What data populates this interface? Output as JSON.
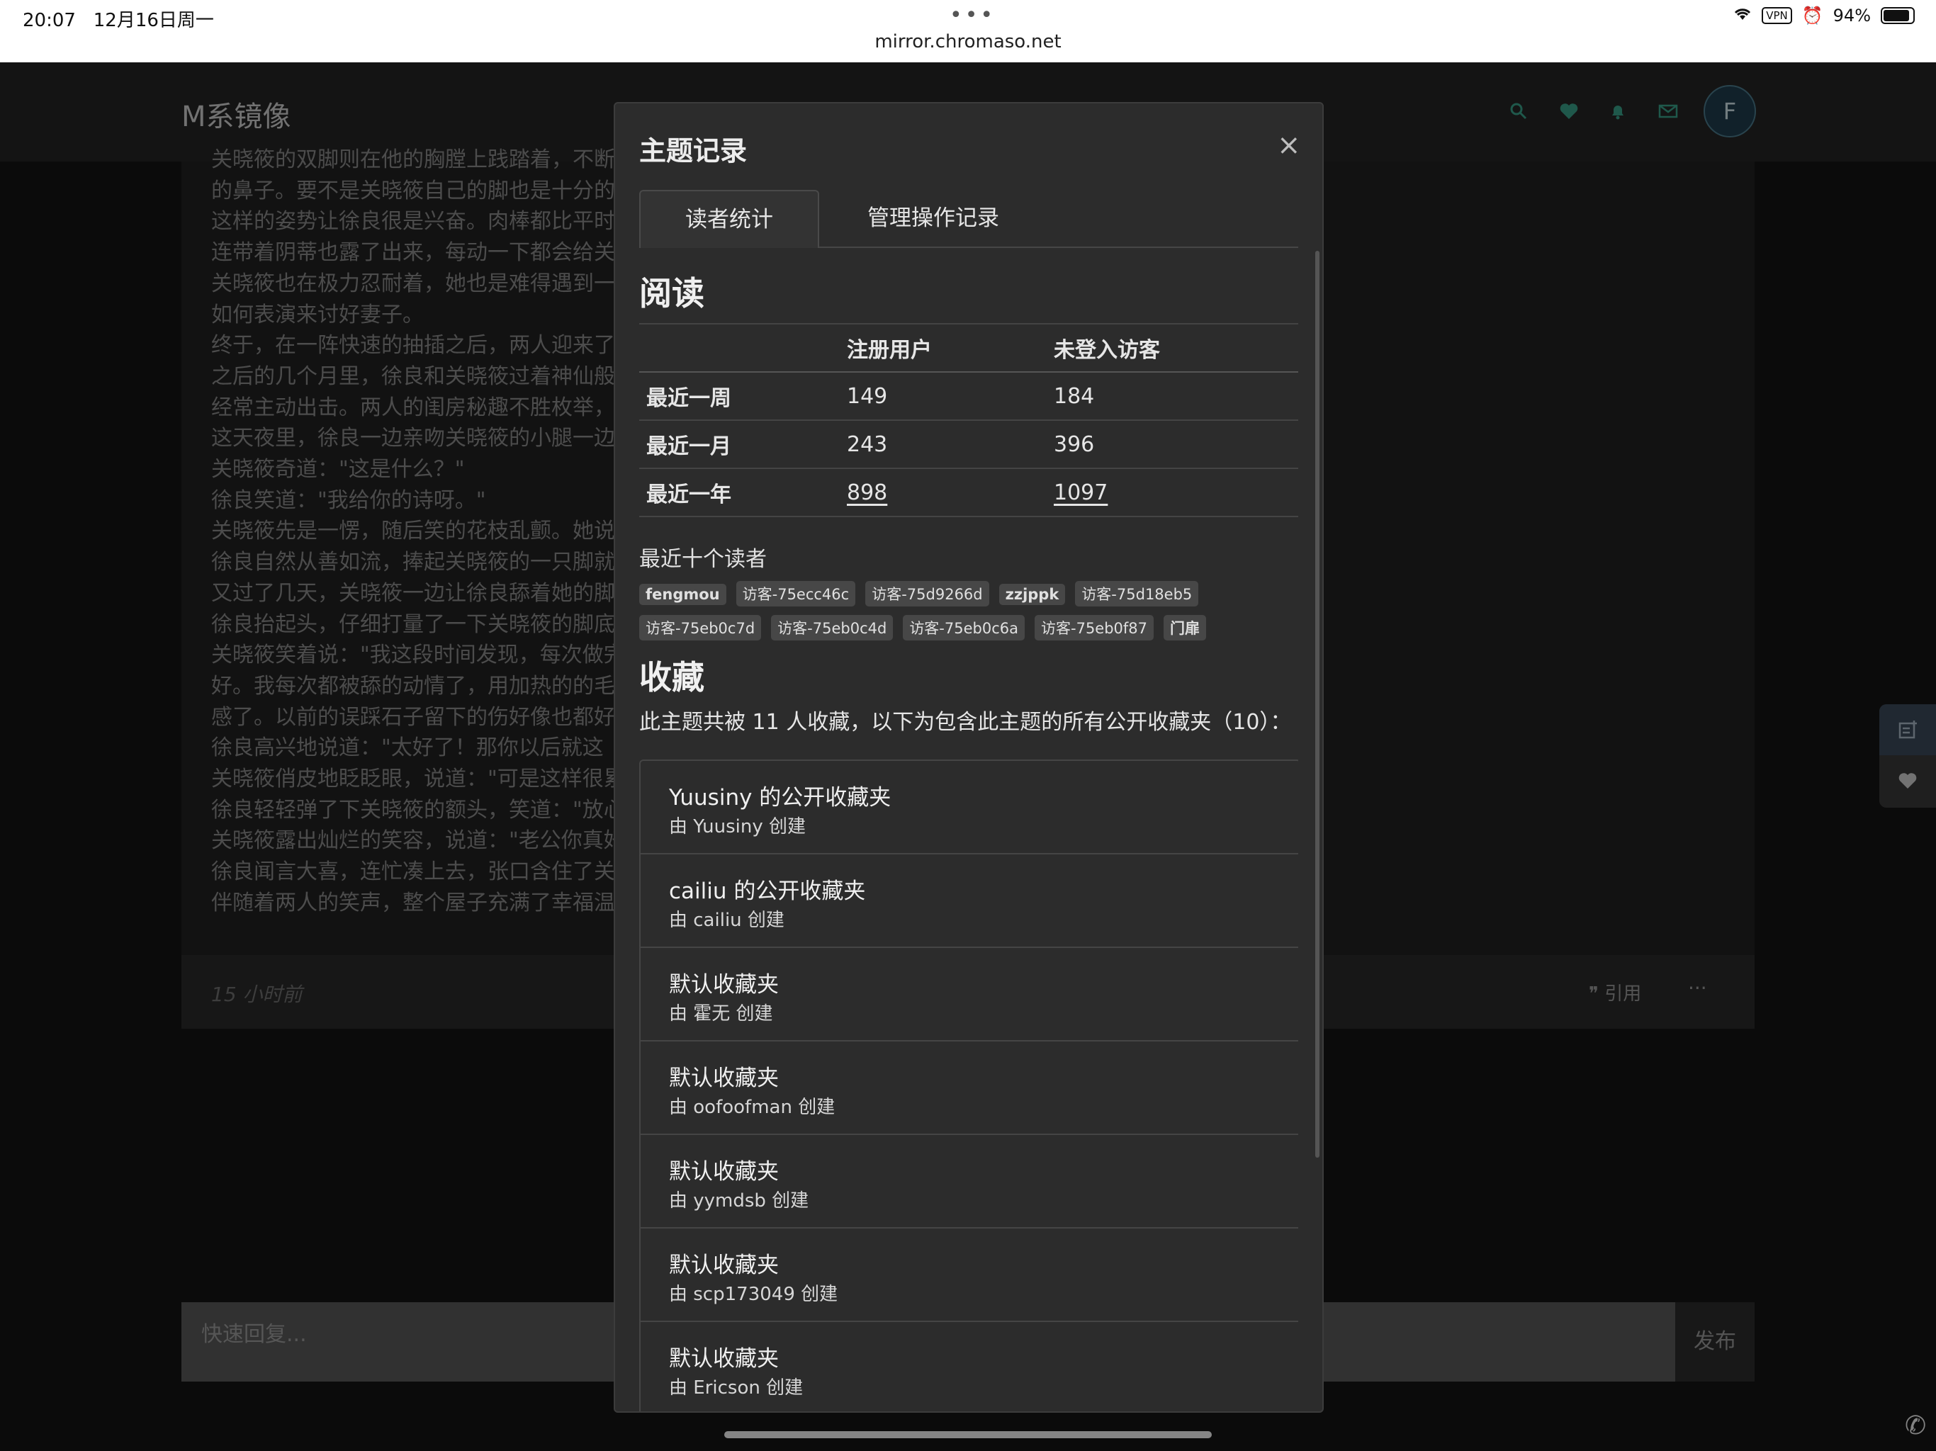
{
  "status_bar": {
    "time": "20:07",
    "date": "12月16日周一",
    "url": "mirror.chromaso.net",
    "vpn": "VPN",
    "battery": "94%"
  },
  "header": {
    "logo": "M系镜像",
    "avatar_letter": "F"
  },
  "post": {
    "lines": [
      "关晓筱的双脚则在他的胸膛上践踏着，不断                                                                                                    去践踏徐良的脸，甚至还会上下摩擦徐良",
      "的鼻子。要不是关晓筱自己的脚也是十分的",
      "这样的姿势让徐良很是兴奋。肉棒都比平时                                                                                                    时不时地还会喷出一小股淫液。",
      "连带着阴蒂也露了出来，每动一下都会给关",
      "关晓筱也在极力忍耐着，她也是难得遇到一                                                                                                    为就没有那么多含义了，不像徐良还想着",
      "如何表演来讨好妻子。",
      "终于，在一阵快速的抽插之后，两人迎来了",
      "之后的几个月里，徐良和关晓筱过着神仙般                                                                                                    的时间都舍不得。而关晓筱也不甘示弱，",
      "经常主动出击。两人的闺房秘趣不胜枚举，",
      "这天夜里，徐良一边亲吻关晓筱的小腿一边",
      "关晓筱奇道：\"这是什么？\"",
      "徐良笑道：\"我给你的诗呀。\"",
      "关晓筱先是一愣，随后笑的花枝乱颤。她说                                                                                                    点什么不好吗？\"",
      "徐良自然从善如流，捧起关晓筱的一只脚就                                                                                                    战。",
      "又过了几天，关晓筱一边让徐良舔着她的脚                                                                                                    \"",
      "徐良抬起头，仔细打量了一下关晓筱的脚底                                                                                                    前更好看了。老婆，你是怎么做到的呀？\"",
      "关晓筱笑着说：\"我这段时间发现，每次做完                                                                                                    。特别是加了你那个很神奇的精液效果更",
      "好。我每次都被舔的动情了，用加热的的毛                                                                                                    最近脚越来越灵活了，活动时已经没有痛",
      "感了。以前的误踩石子留下的伤好像也都好",
      "徐良高兴地说道：\"太好了！那你以后就这",
      "关晓筱俏皮地眨眨眼，说道：\"可是这样很累",
      "徐良轻轻弹了下关晓筱的额头，笑道：\"放心",
      "关晓筱露出灿烂的笑容，说道：\"老公你真好",
      "徐良闻言大喜，连忙凑上去，张口含住了关",
      "伴随着两人的笑声，整个屋子充满了幸福温                                                                                                    静地祝福着这对恋人。"
    ],
    "time": "15 小时前",
    "quote_label": "引用",
    "more_label": "···"
  },
  "reply": {
    "placeholder": "快速回复...",
    "submit_label": "发布"
  },
  "modal": {
    "title": "主题记录",
    "close": "×",
    "tabs": [
      "读者统计",
      "管理操作记录"
    ],
    "reading": {
      "heading": "阅读",
      "columns": [
        "",
        "注册用户",
        "未登入访客"
      ],
      "rows": [
        {
          "label": "最近一周",
          "registered": "149",
          "guests": "184"
        },
        {
          "label": "最近一月",
          "registered": "243",
          "guests": "396"
        },
        {
          "label": "最近一年",
          "registered": "898",
          "guests": "1097"
        }
      ]
    },
    "recent_readers_label": "最近十个读者",
    "recent_readers": [
      "fengmou",
      "访客-75ecc46c",
      "访客-75d9266d",
      "zzjppk",
      "访客-75d18eb5",
      "访客-75eb0c7d",
      "访客-75eb0c4d",
      "访客-75eb0c6a",
      "访客-75eb0f87",
      "门扉"
    ],
    "favorites": {
      "heading": "收藏",
      "description": "此主题共被 11 人收藏，以下为包含此主题的所有公开收藏夹（10）：",
      "items": [
        {
          "name": "Yuusiny 的公开收藏夹",
          "by": "由 Yuusiny 创建"
        },
        {
          "name": "cailiu 的公开收藏夹",
          "by": "由 cailiu 创建"
        },
        {
          "name": "默认收藏夹",
          "by": "由 霍无 创建"
        },
        {
          "name": "默认收藏夹",
          "by": "由 oofoofman 创建"
        },
        {
          "name": "默认收藏夹",
          "by": "由 yymdsb 创建"
        },
        {
          "name": "默认收藏夹",
          "by": "由 scp173049 创建"
        },
        {
          "name": "默认收藏夹",
          "by": "由 Ericson 创建"
        }
      ]
    }
  },
  "colors": {
    "accent": "#3aa189",
    "background": "#141414",
    "modal": "#2c2c2c"
  }
}
